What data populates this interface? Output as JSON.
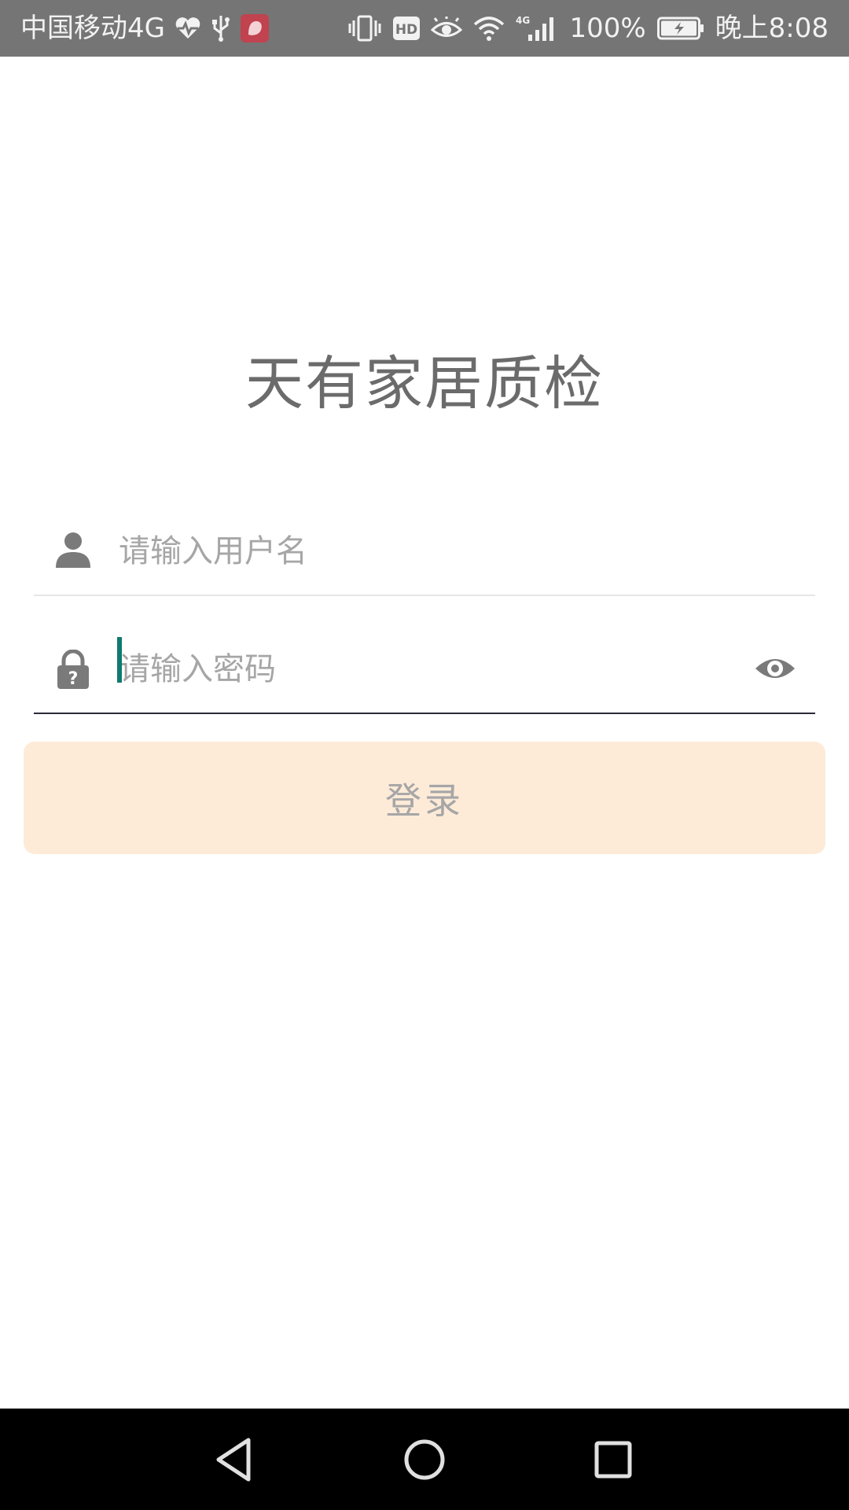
{
  "status_bar": {
    "carrier": "中国移动4G",
    "battery_percent": "100%",
    "time": "晚上8:08",
    "colors": {
      "background": "#757575",
      "notification_badge": "#c0434f"
    },
    "left_icons": [
      "heart-rate-icon",
      "usb-icon",
      "app-notification-icon"
    ],
    "right_icons": [
      "vibrate-icon",
      "hd-icon",
      "eye-icon",
      "wifi-icon",
      "signal-4g-icon",
      "battery-charging-icon"
    ]
  },
  "app": {
    "title": "天有家居质检"
  },
  "form": {
    "username": {
      "placeholder": "请输入用户名",
      "value": "",
      "icon": "person-icon"
    },
    "password": {
      "placeholder": "请输入密码",
      "value": "",
      "icon": "lock-question-icon",
      "toggle_icon": "eye-icon",
      "focused": true
    },
    "login_label": "登录",
    "colors": {
      "button_bg": "#fdebd8",
      "button_text": "#a6a6a6",
      "focus_underline": "#2a2a3a",
      "caret": "#0f7a6e"
    }
  },
  "nav_bar": {
    "buttons": [
      "back-icon",
      "home-icon",
      "recents-icon"
    ]
  }
}
